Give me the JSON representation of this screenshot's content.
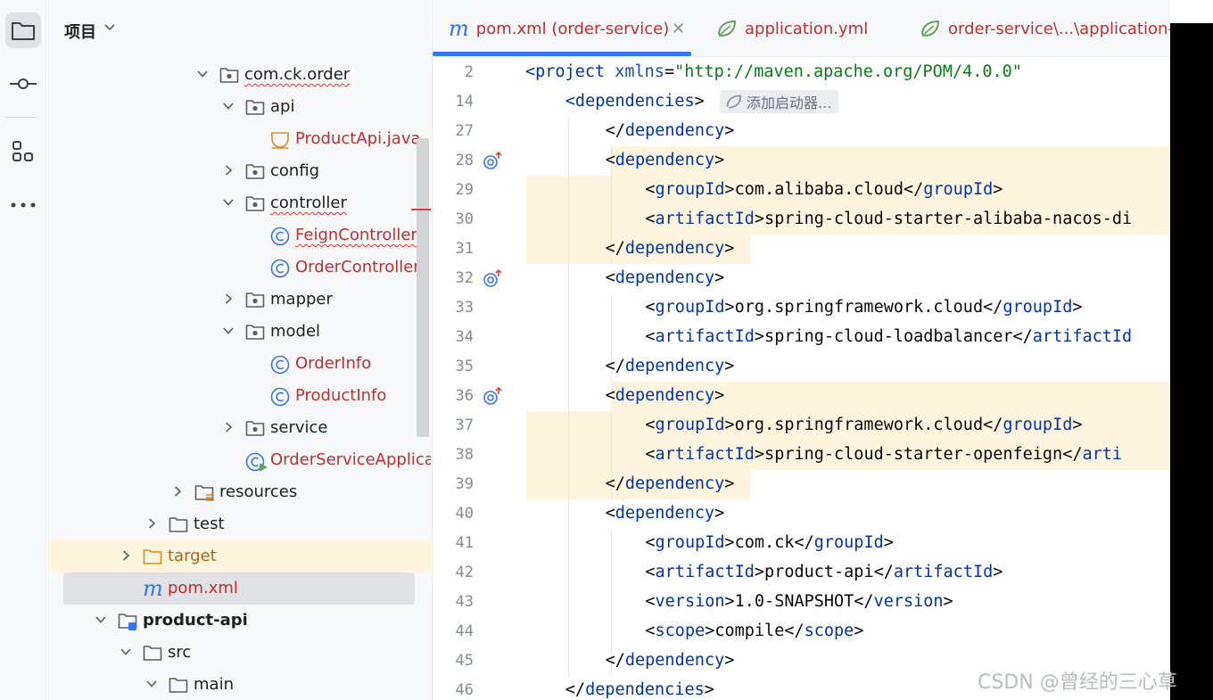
{
  "project_panel": {
    "title": "项目",
    "tree": [
      {
        "label": "com.ck.order",
        "kind": "package"
      },
      {
        "label": "api",
        "kind": "package"
      },
      {
        "label": "ProductApi.java",
        "kind": "interface"
      },
      {
        "label": "config",
        "kind": "package"
      },
      {
        "label": "controller",
        "kind": "package"
      },
      {
        "label": "FeignController",
        "kind": "class"
      },
      {
        "label": "OrderController",
        "kind": "class"
      },
      {
        "label": "mapper",
        "kind": "package"
      },
      {
        "label": "model",
        "kind": "package"
      },
      {
        "label": "OrderInfo",
        "kind": "class"
      },
      {
        "label": "ProductInfo",
        "kind": "class"
      },
      {
        "label": "service",
        "kind": "package"
      },
      {
        "label": "OrderServiceApplicat",
        "kind": "spring-class"
      },
      {
        "label": "resources",
        "kind": "resources-folder"
      },
      {
        "label": "test",
        "kind": "folder"
      },
      {
        "label": "target",
        "kind": "excluded-folder"
      },
      {
        "label": "pom.xml",
        "kind": "maven"
      },
      {
        "label": "product-api",
        "kind": "module"
      },
      {
        "label": "src",
        "kind": "folder"
      },
      {
        "label": "main",
        "kind": "folder"
      }
    ]
  },
  "editor": {
    "tabs": [
      {
        "label": "pom.xml (order-service)",
        "icon": "maven-icon",
        "active": true
      },
      {
        "label": "application.yml",
        "icon": "spring-leaf-icon"
      },
      {
        "label": "order-service\\...\\application-d",
        "icon": "spring-leaf-icon"
      }
    ],
    "inlay_hint": "添加启动器...",
    "lines": [
      {
        "n": "2",
        "indent": 0,
        "parts": [
          [
            "tag",
            "<project "
          ],
          [
            "attr",
            "xmlns"
          ],
          [
            "plain",
            "="
          ],
          [
            "str",
            "\"http://maven.apache.org/POM/4.0.0\""
          ]
        ]
      },
      {
        "n": "14",
        "indent": 1,
        "parts": [
          [
            "tag",
            "<dependencies"
          ],
          [
            "plain",
            ">"
          ]
        ]
      },
      {
        "n": "27",
        "indent": 2,
        "parts": [
          [
            "plain",
            "</"
          ],
          [
            "tag",
            "dependency"
          ],
          [
            "plain",
            ">"
          ]
        ]
      },
      {
        "n": "28",
        "indent": 2,
        "parts": [
          [
            "plain",
            "<"
          ],
          [
            "tag",
            "dependency"
          ],
          [
            "plain",
            ">"
          ]
        ]
      },
      {
        "n": "29",
        "indent": 3,
        "parts": [
          [
            "plain",
            "<"
          ],
          [
            "tag",
            "groupId"
          ],
          [
            "plain",
            ">com.alibaba.cloud</"
          ],
          [
            "tag",
            "groupId"
          ],
          [
            "plain",
            ">"
          ]
        ]
      },
      {
        "n": "30",
        "indent": 3,
        "parts": [
          [
            "plain",
            "<"
          ],
          [
            "tag",
            "artifactId"
          ],
          [
            "plain",
            ">spring-cloud-starter-alibaba-nacos-di"
          ]
        ]
      },
      {
        "n": "31",
        "indent": 2,
        "parts": [
          [
            "plain",
            "</"
          ],
          [
            "tag",
            "dependency"
          ],
          [
            "plain",
            ">"
          ]
        ]
      },
      {
        "n": "32",
        "indent": 2,
        "parts": [
          [
            "plain",
            "<"
          ],
          [
            "tag",
            "dependency"
          ],
          [
            "plain",
            ">"
          ]
        ]
      },
      {
        "n": "33",
        "indent": 3,
        "parts": [
          [
            "plain",
            "<"
          ],
          [
            "tag",
            "groupId"
          ],
          [
            "plain",
            ">org.springframework.cloud</"
          ],
          [
            "tag",
            "groupId"
          ],
          [
            "plain",
            ">"
          ]
        ]
      },
      {
        "n": "34",
        "indent": 3,
        "parts": [
          [
            "plain",
            "<"
          ],
          [
            "tag",
            "artifactId"
          ],
          [
            "plain",
            ">spring-cloud-loadbalancer</"
          ],
          [
            "tag",
            "artifactId"
          ]
        ]
      },
      {
        "n": "35",
        "indent": 2,
        "parts": [
          [
            "plain",
            "</"
          ],
          [
            "tag",
            "dependency"
          ],
          [
            "plain",
            ">"
          ]
        ]
      },
      {
        "n": "36",
        "indent": 2,
        "parts": [
          [
            "plain",
            "<"
          ],
          [
            "tag",
            "dependency"
          ],
          [
            "plain",
            ">"
          ]
        ]
      },
      {
        "n": "37",
        "indent": 3,
        "parts": [
          [
            "plain",
            "<"
          ],
          [
            "tag",
            "groupId"
          ],
          [
            "plain",
            ">org.springframework.cloud</"
          ],
          [
            "tag",
            "groupId"
          ],
          [
            "plain",
            ">"
          ]
        ]
      },
      {
        "n": "38",
        "indent": 3,
        "parts": [
          [
            "plain",
            "<"
          ],
          [
            "tag",
            "artifactId"
          ],
          [
            "plain",
            ">spring-cloud-starter-openfeign</"
          ],
          [
            "tag",
            "arti"
          ]
        ]
      },
      {
        "n": "39",
        "indent": 2,
        "parts": [
          [
            "plain",
            "</"
          ],
          [
            "tag",
            "dependency"
          ],
          [
            "plain",
            ">"
          ]
        ]
      },
      {
        "n": "40",
        "indent": 2,
        "parts": [
          [
            "plain",
            "<"
          ],
          [
            "tag",
            "dependency"
          ],
          [
            "plain",
            ">"
          ]
        ]
      },
      {
        "n": "41",
        "indent": 3,
        "parts": [
          [
            "plain",
            "<"
          ],
          [
            "tag",
            "groupId"
          ],
          [
            "plain",
            ">com.ck</"
          ],
          [
            "tag",
            "groupId"
          ],
          [
            "plain",
            ">"
          ]
        ]
      },
      {
        "n": "42",
        "indent": 3,
        "parts": [
          [
            "plain",
            "<"
          ],
          [
            "tag",
            "artifactId"
          ],
          [
            "plain",
            ">product-api</"
          ],
          [
            "tag",
            "artifactId"
          ],
          [
            "plain",
            ">"
          ]
        ]
      },
      {
        "n": "43",
        "indent": 3,
        "parts": [
          [
            "plain",
            "<"
          ],
          [
            "tag",
            "version"
          ],
          [
            "plain",
            ">1.0-SNAPSHOT</"
          ],
          [
            "tag",
            "version"
          ],
          [
            "plain",
            ">"
          ]
        ]
      },
      {
        "n": "44",
        "indent": 3,
        "parts": [
          [
            "plain",
            "<"
          ],
          [
            "tag",
            "scope"
          ],
          [
            "plain",
            ">compile</"
          ],
          [
            "tag",
            "scope"
          ],
          [
            "plain",
            ">"
          ]
        ]
      },
      {
        "n": "45",
        "indent": 2,
        "parts": [
          [
            "plain",
            "</"
          ],
          [
            "tag",
            "dependency"
          ],
          [
            "plain",
            ">"
          ]
        ]
      },
      {
        "n": "46",
        "indent": 1,
        "parts": [
          [
            "plain",
            "</"
          ],
          [
            "tag",
            "dependencies"
          ],
          [
            "plain",
            ">"
          ]
        ]
      }
    ]
  },
  "watermark": "CSDN @曾经的三心草",
  "colors": {
    "accent": "#3574f0",
    "tag": "#0033b3",
    "string": "#067d17",
    "highlight": "#fdf5de",
    "modified_file": "#c22e2e"
  }
}
